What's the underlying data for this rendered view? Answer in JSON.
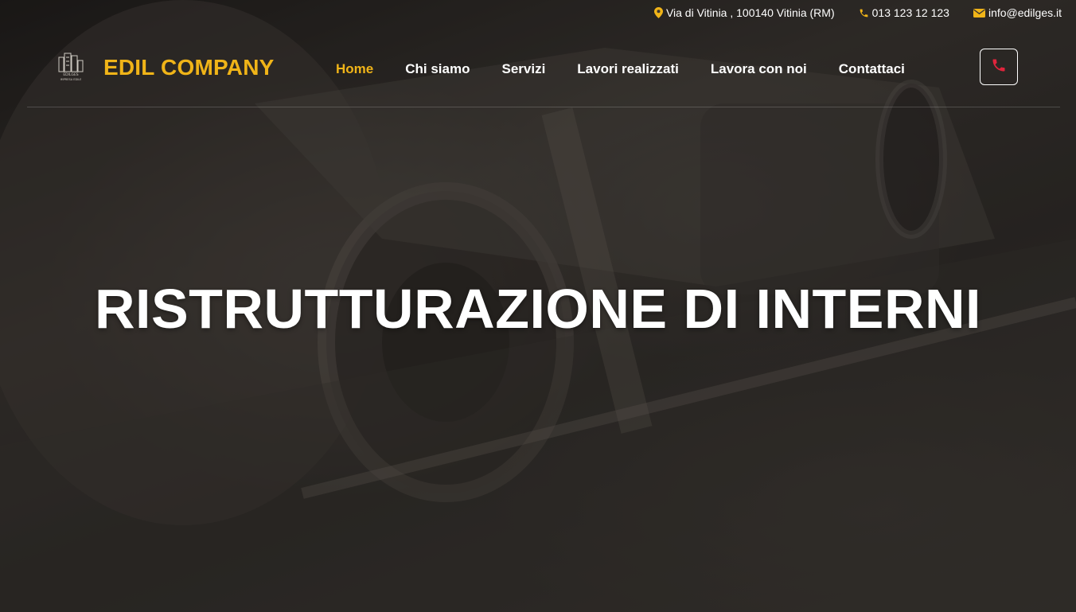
{
  "topbar": {
    "address": "Via di Vitinia , 100140 Vitinia (RM)",
    "phone": "013 123 12 123",
    "email": "info@edilges.it",
    "icon_color": "#f0b418"
  },
  "header": {
    "brand": "EDIL COMPANY",
    "logo_text_top": "EDILGES",
    "logo_text_bottom": "IMPRESA EDILE",
    "brand_color": "#f0b418",
    "nav": [
      {
        "label": "Home",
        "active": true
      },
      {
        "label": "Chi siamo",
        "active": false
      },
      {
        "label": "Servizi",
        "active": false
      },
      {
        "label": "Lavori realizzati",
        "active": false
      },
      {
        "label": "Lavora con noi",
        "active": false
      },
      {
        "label": "Contattaci",
        "active": false
      }
    ],
    "call_icon": "phone-icon",
    "call_icon_color": "#e0243c"
  },
  "hero": {
    "title": "RISTRUTTURAZIONE DI INTERNI"
  }
}
